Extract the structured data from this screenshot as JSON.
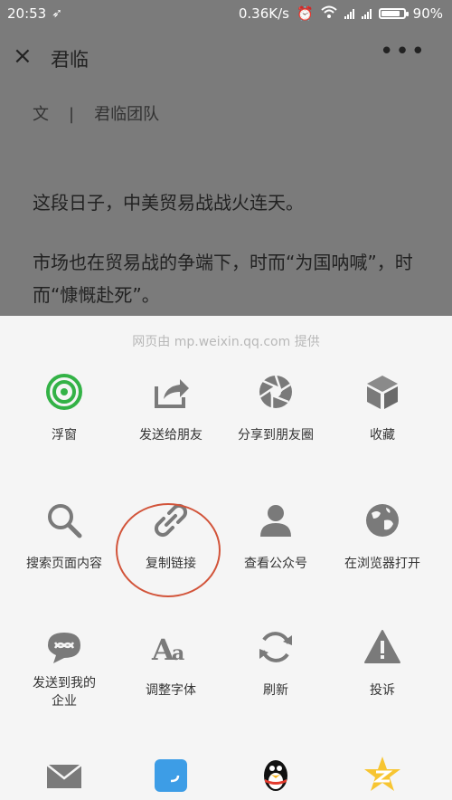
{
  "status_bar": {
    "time": "20:53",
    "network_speed": "0.36K/s",
    "battery_percent": "90%",
    "battery_level": 0.9
  },
  "navbar": {
    "close_icon": "×",
    "title": "君临",
    "more_icon": "•••"
  },
  "article": {
    "byline_prefix": "文",
    "byline_separator": "|",
    "author": "君临团队",
    "paragraph_1": "这段日子，中美贸易战战火连天。",
    "paragraph_2": "市场也在贸易战的争端下，时而“为国呐喊”，时而“慷慨赴死”。"
  },
  "share_sheet": {
    "provider": "网页由 mp.weixin.qq.com 提供",
    "row1": [
      {
        "label": "浮窗",
        "icon": "floating-window-icon"
      },
      {
        "label": "发送给朋友",
        "icon": "share-forward-icon"
      },
      {
        "label": "分享到朋友圈",
        "icon": "moments-aperture-icon"
      },
      {
        "label": "收藏",
        "icon": "favorite-cube-icon"
      }
    ],
    "row2": [
      {
        "label": "搜索页面内容",
        "icon": "search-icon"
      },
      {
        "label": "复制链接",
        "icon": "link-icon"
      },
      {
        "label": "查看公众号",
        "icon": "person-icon"
      },
      {
        "label": "在浏览器打开",
        "icon": "globe-icon"
      }
    ],
    "row3": [
      {
        "label": "发送到我的\n企业",
        "icon": "enterprise-icon"
      },
      {
        "label": "调整字体",
        "icon": "font-size-icon"
      },
      {
        "label": "刷新",
        "icon": "refresh-icon"
      },
      {
        "label": "投诉",
        "icon": "warning-icon"
      }
    ],
    "row4": [
      {
        "label": "",
        "icon": "mail-icon"
      },
      {
        "label": "",
        "icon": "blue-app-icon"
      },
      {
        "label": "",
        "icon": "qq-penguin-icon"
      },
      {
        "label": "",
        "icon": "qzone-star-icon"
      }
    ],
    "accent_green": "#33b246",
    "icon_gray": "#7a7a7a",
    "highlight_color": "#d2543a"
  }
}
